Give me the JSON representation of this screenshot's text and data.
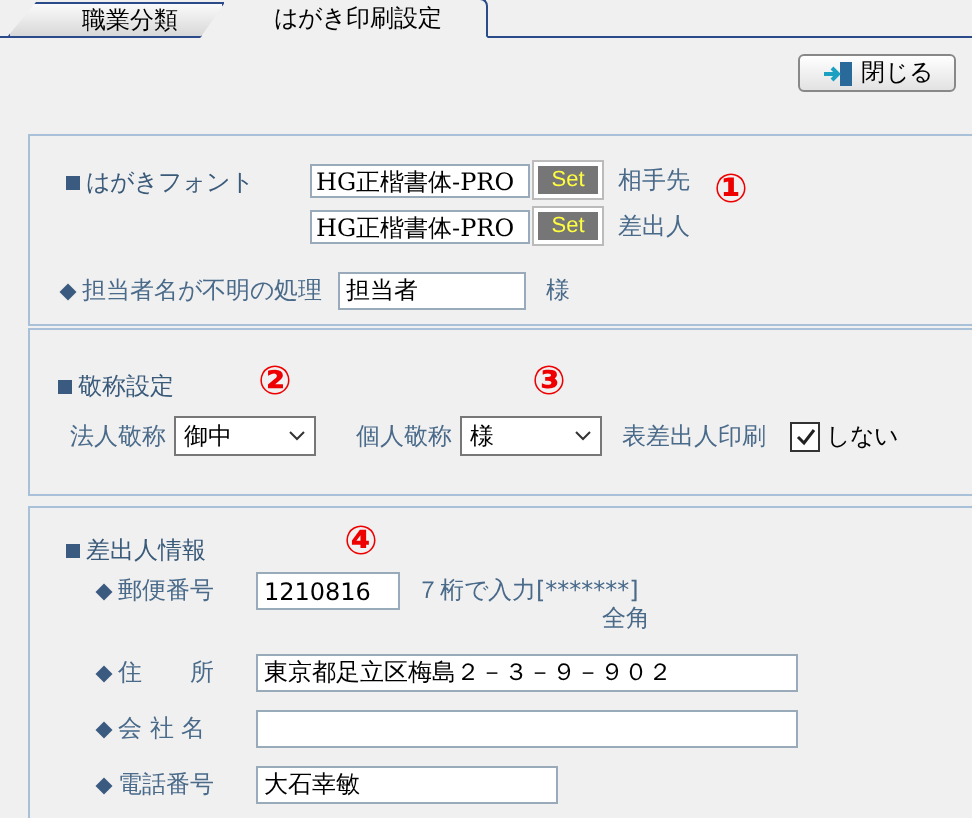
{
  "tabs": [
    {
      "label": "職業分類",
      "selected": false
    },
    {
      "label": "はがき印刷設定",
      "selected": true
    }
  ],
  "close_button": {
    "label": "閉じる"
  },
  "font_section": {
    "title": "はがきフォント",
    "marker": "①",
    "rows": [
      {
        "value": "HG正楷書体-PRO",
        "button": "Set",
        "label": "相手先"
      },
      {
        "value": "HG正楷書体-PRO",
        "button": "Set",
        "label": "差出人"
      }
    ]
  },
  "unknown_name": {
    "label": "担当者名が不明の処理",
    "value": "担当者",
    "suffix": "様"
  },
  "honorific_section": {
    "title": "敬称設定",
    "corporate": {
      "label": "法人敬称",
      "value": "御中",
      "marker": "②"
    },
    "personal": {
      "label": "個人敬称",
      "value": "様",
      "marker": "③"
    },
    "print": {
      "label": "表差出人印刷",
      "checkbox_label": "しない",
      "checked": true
    }
  },
  "sender_section": {
    "title": "差出人情報",
    "fields": [
      {
        "label": "郵便番号",
        "value": "1210816",
        "kind": "short",
        "marker": "④",
        "hint": "７桁で入力[*******]",
        "note": "全角"
      },
      {
        "label": "住　　所",
        "value": "東京都足立区梅島２－３－９－９０２",
        "kind": "long"
      },
      {
        "label": "会 社 名",
        "kind": "long"
      },
      {
        "label": "電話番号",
        "value": "大石幸敏",
        "kind": "medium"
      }
    ]
  }
}
